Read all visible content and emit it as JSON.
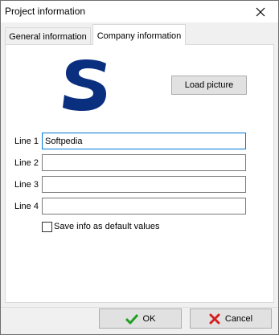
{
  "window": {
    "title": "Project information"
  },
  "tabs": [
    {
      "label": "General information",
      "active": false
    },
    {
      "label": "Company information",
      "active": true
    }
  ],
  "logo": {
    "letter": "S",
    "color": "#0b2f7f"
  },
  "load_picture_label": "Load picture",
  "lines": [
    {
      "label": "Line 1",
      "value": "Softpedia"
    },
    {
      "label": "Line 2",
      "value": ""
    },
    {
      "label": "Line 3",
      "value": ""
    },
    {
      "label": "Line 4",
      "value": ""
    }
  ],
  "save_default_label": "Save info as default values",
  "save_default_checked": false,
  "buttons": {
    "ok": "OK",
    "cancel": "Cancel"
  },
  "colors": {
    "ok_check": "#20a020",
    "cancel_x": "#d42020",
    "focus": "#0078d7"
  }
}
